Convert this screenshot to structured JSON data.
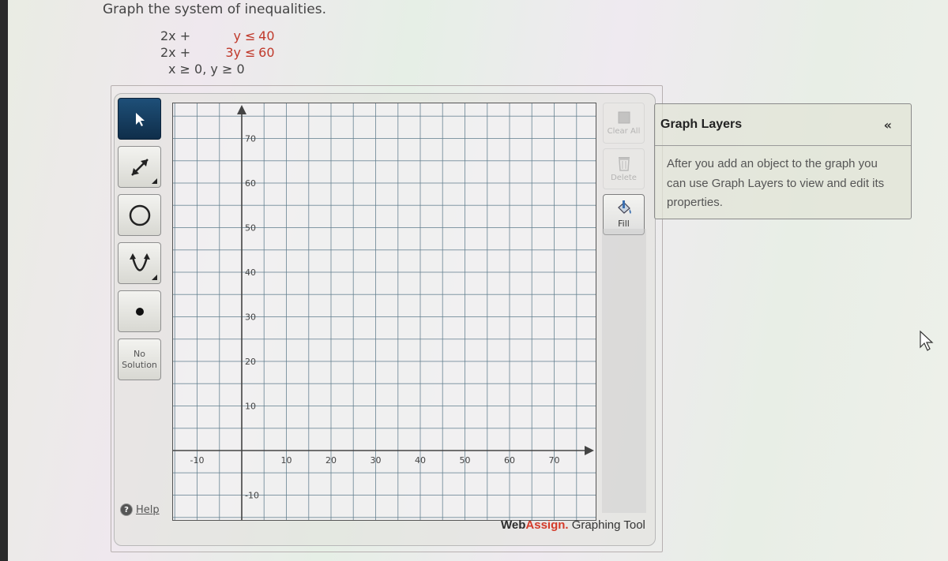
{
  "question": {
    "prompt": "Graph the system of inequalities.",
    "inequalities": [
      {
        "lhs_x": "2x +",
        "lhs_y": "y",
        "op": "≤",
        "rhs": "40"
      },
      {
        "lhs_x": "2x +",
        "lhs_y": "3y",
        "op": "≤",
        "rhs": "60"
      }
    ],
    "constraints": "x ≥ 0, y ≥ 0"
  },
  "toolbar": {
    "tools": [
      {
        "name": "select-tool",
        "icon": "pointer-icon",
        "active": true
      },
      {
        "name": "line-tool",
        "icon": "line-arrow-icon",
        "active": false,
        "has_submenu": true
      },
      {
        "name": "circle-tool",
        "icon": "circle-icon",
        "active": false
      },
      {
        "name": "parabola-tool",
        "icon": "parabola-icon",
        "active": false,
        "has_submenu": true
      },
      {
        "name": "point-tool",
        "icon": "point-icon",
        "active": false
      },
      {
        "name": "no-solution-tool",
        "label_line1": "No",
        "label_line2": "Solution",
        "active": false
      }
    ],
    "help_label": "Help"
  },
  "right_tools": {
    "clear_all_label": "Clear All",
    "delete_label": "Delete",
    "fill_label": "Fill"
  },
  "graph": {
    "x_min": -15,
    "x_max": 77,
    "y_min": -15,
    "y_max": 77,
    "grid_step": 5,
    "label_step": 10,
    "x_labels": [
      "-10",
      "10",
      "20",
      "30",
      "40",
      "50",
      "60",
      "70"
    ],
    "y_labels": [
      "70",
      "60",
      "50",
      "40",
      "30",
      "20",
      "10",
      "-10"
    ]
  },
  "layers": {
    "title": "Graph Layers",
    "collapse_icon": "«",
    "body": "After you add an object to the graph you can use Graph Layers to view and edit its properties."
  },
  "branding": {
    "web": "Web",
    "assign": "Assign.",
    "rest": " Graphing Tool",
    "accent": "#d43b2a"
  },
  "colors": {
    "active_tool": "#163d60",
    "inequality_red": "#c0392b"
  }
}
